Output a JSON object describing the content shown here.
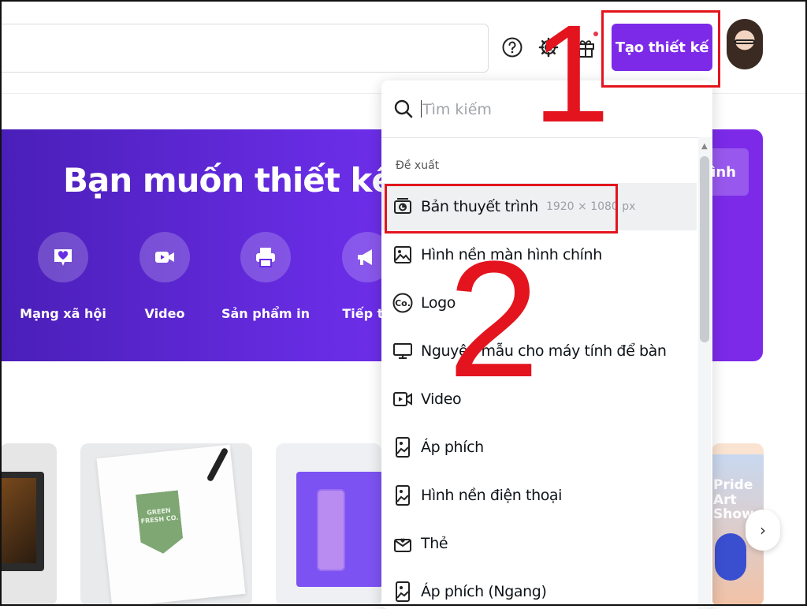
{
  "header": {
    "create_button": "Tạo thiết kế",
    "icons": [
      "help-icon",
      "gear-icon",
      "gift-icon"
    ],
    "notification_color": "#e6374c"
  },
  "hero": {
    "title": "Bạn muốn thiết kế gì?",
    "right_button": "ình",
    "categories": [
      {
        "label": "Mạng xã hội",
        "icon": "heart-chat-icon"
      },
      {
        "label": "Video",
        "icon": "video-camera-icon"
      },
      {
        "label": "Sản phẩm in",
        "icon": "printer-icon"
      },
      {
        "label": "Tiếp th",
        "icon": "megaphone-icon"
      }
    ]
  },
  "dropdown": {
    "search_placeholder": "Tìm kiếm",
    "section_label": "Đề xuất",
    "items": [
      {
        "label": "Bản thuyết trình",
        "dims": "1920 × 1080 px",
        "icon": "presentation-icon"
      },
      {
        "label": "Hình nền màn hình chính",
        "icon": "image-icon"
      },
      {
        "label": "Logo",
        "icon": "logo-icon"
      },
      {
        "label": "Nguyên mẫu cho máy tính để bàn",
        "icon": "desktop-icon"
      },
      {
        "label": "Video",
        "icon": "video-icon"
      },
      {
        "label": "Áp phích",
        "icon": "poster-icon"
      },
      {
        "label": "Hình nền điện thoại",
        "icon": "phone-wallpaper-icon"
      },
      {
        "label": "Thẻ",
        "icon": "card-icon"
      },
      {
        "label": "Áp phích (Ngang)",
        "icon": "poster-landscape-icon"
      }
    ]
  },
  "cards": {
    "green_logo_text": "GREEN FRESH CO.",
    "pride_text": "Pride Art Showca"
  },
  "annotations": {
    "step1": "1",
    "step2": "2",
    "color": "#e3141e"
  },
  "colors": {
    "brand_purple": "#7d2ae8"
  }
}
